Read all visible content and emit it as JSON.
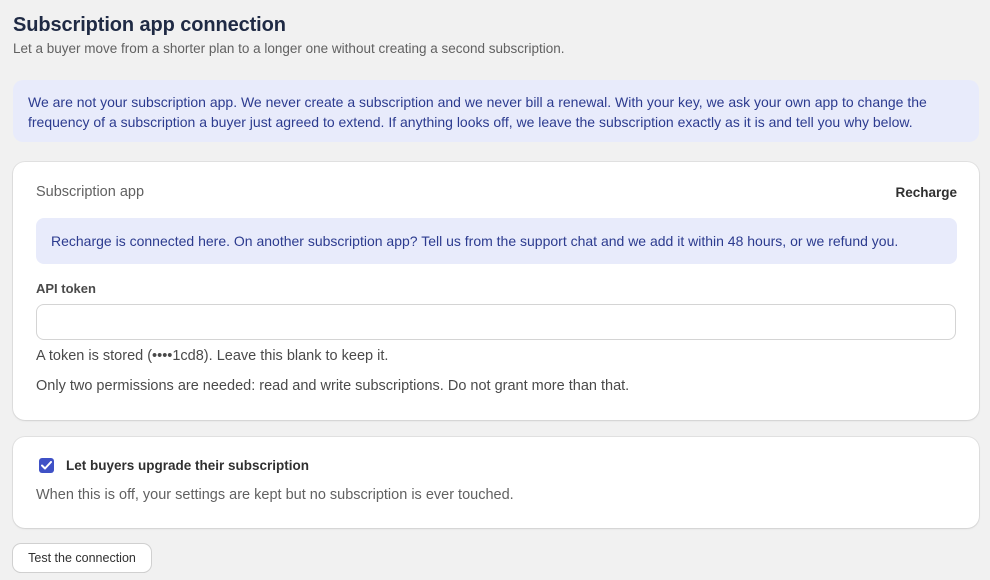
{
  "header": {
    "title": "Subscription app connection",
    "subtitle": "Let a buyer move from a shorter plan to a longer one without creating a second subscription."
  },
  "info_banner": {
    "text": "We are not your subscription app. We never create a subscription and we never bill a renewal. With your key, we ask your own app to change the frequency of a subscription a buyer just agreed to extend. If anything looks off, we leave the subscription exactly as it is and tell you why below."
  },
  "app_card": {
    "app_label": "Subscription app",
    "app_value": "Recharge",
    "note": "Recharge is connected here. On another subscription app? Tell us from the support chat and we add it within 48 hours, or we refund you.",
    "token_label": "API token",
    "token_value": "",
    "token_placeholder": "",
    "token_help": "A token is stored (••••1cd8). Leave this blank to keep it.",
    "permissions_help": "Only two permissions are needed: read and write subscriptions. Do not grant more than that."
  },
  "upgrade_card": {
    "checkbox_label": "Let buyers upgrade their subscription",
    "checked": true,
    "help": "When this is off, your settings are kept but no subscription is ever touched."
  },
  "actions": {
    "test_label": "Test the connection"
  },
  "colors": {
    "accent": "#3f51c6",
    "banner_bg": "#e8ebfb",
    "banner_text": "#2c3b8f",
    "page_bg": "#f1f1f1"
  },
  "icons": {
    "checkbox": "check-icon"
  }
}
